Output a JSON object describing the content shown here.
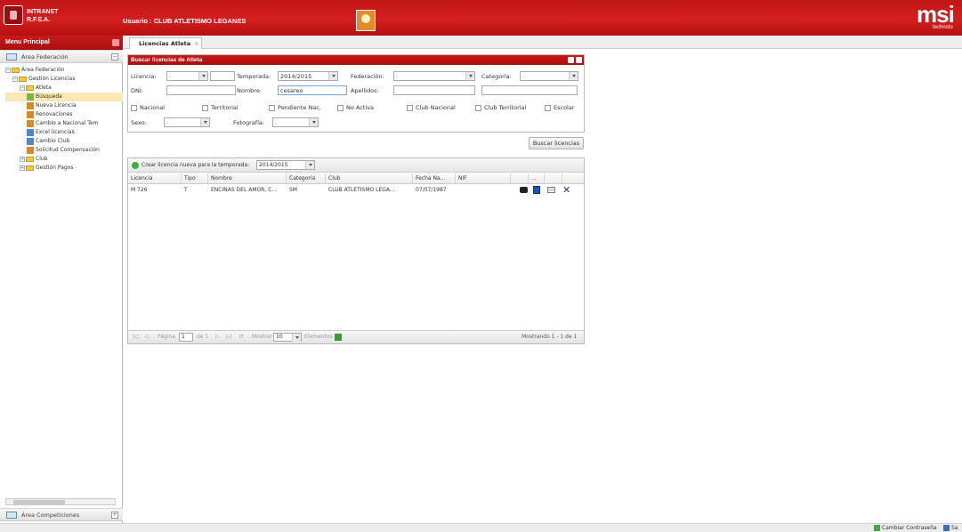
{
  "header": {
    "app_line1": "INTRANET",
    "app_line2": "R.F.E.A.",
    "user_label": "Usuario : CLUB ATLETISMO LEGANES",
    "brand": "msi",
    "brand_sub": "technolo"
  },
  "sidebar": {
    "title": "Menu Principal",
    "section_top": "Área Federación",
    "section_bottom": "Área Competiciones",
    "tree": [
      {
        "label": "Área Federación",
        "indent": 0,
        "type": "folder"
      },
      {
        "label": "Gestión Licencias",
        "indent": 1,
        "type": "folder"
      },
      {
        "label": "Atleta",
        "indent": 2,
        "type": "folder"
      },
      {
        "label": "Búsqueda",
        "indent": 3,
        "type": "search",
        "selected": true
      },
      {
        "label": "Nueva Licencia",
        "indent": 3,
        "type": "user"
      },
      {
        "label": "Renovaciones",
        "indent": 3,
        "type": "user"
      },
      {
        "label": "Cambio a Nacional Tem",
        "indent": 3,
        "type": "user"
      },
      {
        "label": "Excel licencias",
        "indent": 3,
        "type": "sheet"
      },
      {
        "label": "Cambio Club",
        "indent": 3,
        "type": "sheet"
      },
      {
        "label": "Solicitud Compensación",
        "indent": 3,
        "type": "user"
      },
      {
        "label": "Club",
        "indent": 2,
        "type": "folder"
      },
      {
        "label": "Gestión Pagos",
        "indent": 2,
        "type": "folder"
      }
    ]
  },
  "tabs": [
    {
      "label": "Licencias Atleta",
      "close": "×"
    }
  ],
  "search": {
    "title": "Buscar licencias de Atleta",
    "licencia_label": "Licencia:",
    "licencia_value": "-",
    "temporada_label": "Temporada:",
    "temporada_value": "2014/2015",
    "federacion_label": "Federación:",
    "federacion_value": "-",
    "categoria_label": "Categoría:",
    "categoria_value": "-",
    "dni_label": "DNI:",
    "nombre_label": "Nombre:",
    "nombre_value": "cesareo",
    "apellidos_label": "Apellidos:",
    "checkboxes": [
      "Nacional",
      "Territorial",
      "Pendiente Nac.",
      "No Activa",
      "Club Nacional",
      "Club Territorial",
      "Escolar"
    ],
    "sexo_label": "Sexo:",
    "sexo_value": "-",
    "fotografia_label": "Fotografía:",
    "fotografia_value": "-",
    "button": "Buscar licencias"
  },
  "grid": {
    "add_label": "Crear licencia nueva para la temporada:",
    "add_season": "2014/2015",
    "columns": [
      "Licencia",
      "Tipo",
      "Nombre",
      "Categoría",
      "Club",
      "Fecha Na...",
      "NIF",
      "",
      "...",
      ""
    ],
    "rows": [
      {
        "licencia": "M 726",
        "tipo": "T",
        "nombre": "ENCINAS DEL AMOR, C...",
        "categoria": "SM",
        "club": "CLUB ATLETISMO LEGA...",
        "fecha": "07/07/1987",
        "nif": ""
      }
    ],
    "pager": {
      "page_label": "Página",
      "page_value": "1",
      "of_label": "de 1",
      "show_label": "Mostrar",
      "show_value": "10",
      "elements_label": "Elementos",
      "summary": "Mostrando 1 - 1 de 1"
    }
  },
  "status": {
    "change_password": "Cambiar Contraseña",
    "exit": "Sa"
  },
  "colors": {
    "brand_red": "#c21616",
    "accent_blue": "#355a8e"
  }
}
